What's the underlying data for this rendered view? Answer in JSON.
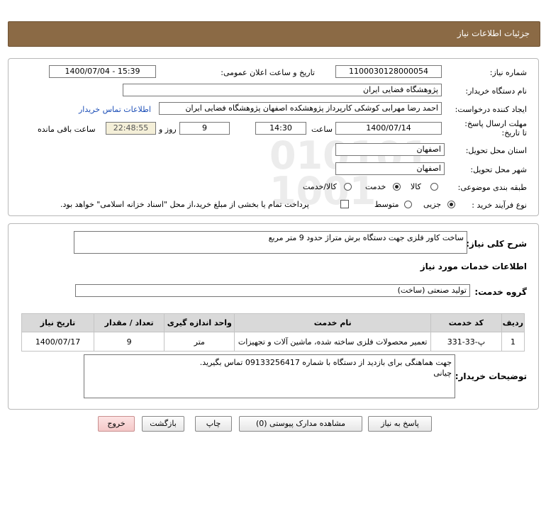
{
  "header": {
    "title": "جزئیات اطلاعات نیاز"
  },
  "form": {
    "need_number_label": "شماره نیاز:",
    "need_number": "1100030128000054",
    "announce_label": "تاریخ و ساعت اعلان عمومی:",
    "announce_value": "1400/07/04 - 15:39",
    "buyer_org_label": "نام دستگاه خریدار:",
    "buyer_org": "پژوهشگاه فضایی ایران",
    "requester_label": "ایجاد کننده درخواست:",
    "requester": "احمد رضا مهرابی کوشکی کارپرداز پژوهشکده اصفهان پژوهشگاه فضایی ایران",
    "contact_link": "اطلاعات تماس خریدار",
    "deadline_label": "مهلت ارسال پاسخ: تا تاریخ:",
    "deadline_date": "1400/07/14",
    "time_label": "ساعت",
    "deadline_time": "14:30",
    "days_value": "9",
    "days_label": "روز و",
    "remaining_time": "22:48:55",
    "remaining_label": "ساعت باقی مانده",
    "province_label": "استان محل تحویل:",
    "province": "اصفهان",
    "city_label": "شهر محل تحویل:",
    "city": "اصفهان",
    "category_label": "طبقه بندی موضوعی:",
    "category_options": [
      "کالا",
      "خدمت",
      "کالا/خدمت"
    ],
    "category_selected": "خدمت",
    "process_label": "نوع فرآیند خرید :",
    "process_options": [
      "جزیی",
      "متوسط"
    ],
    "process_selected": "جزیی",
    "treasury_note": "پرداخت تمام یا بخشی از مبلغ خرید،از محل \"اسناد خزانه اسلامی\" خواهد بود."
  },
  "details": {
    "summary_label": "شرح کلی نیاز:",
    "summary": "ساخت کاور فلزی جهت دستگاه برش متراژ حدود 9 متر مربع",
    "services_heading": "اطلاعات خدمات مورد نیاز",
    "service_group_label": "گروه خدمت:",
    "service_group": "تولید صنعتی (ساخت)",
    "table": {
      "headers": [
        "ردیف",
        "کد خدمت",
        "نام خدمت",
        "واحد اندازه گیری",
        "تعداد / مقدار",
        "تاریخ نیاز"
      ],
      "rows": [
        [
          "1",
          "پ-33-331",
          "تعمیر محصولات فلزی ساخته شده، ماشین آلات و تجهیزات",
          "متر",
          "9",
          "1400/07/17"
        ]
      ]
    },
    "buyer_notes_label": "توضیحات خریدار:",
    "buyer_notes_line1": "جهت هماهنگی برای بازدید از دستگاه با شماره 09133256417 تماس بگیرید.",
    "buyer_notes_line2": "چیانی"
  },
  "buttons": {
    "reply": "پاسخ به نیاز",
    "attachments": "مشاهده مدارک پیوستی (0)",
    "print": "چاپ",
    "back": "بازگشت",
    "exit": "خروج"
  },
  "watermark": {
    "line1": "ParsNamadData",
    "line2": "مرکز فرآوری اطلاعات پارس نماد داده",
    "line3": "پایگاه اطلاع رسانی مناقصه و مزایده",
    "line4": "۰۲۱-۸۸۳۴۹۶۷۰-۵"
  },
  "colors": {
    "header_bg": "#8b6a45",
    "table_header_bg": "#d9d9d9",
    "remaining_bg": "#f4efd8",
    "link": "#1d4fb7",
    "danger_button_bg": "#f4c8c8"
  }
}
